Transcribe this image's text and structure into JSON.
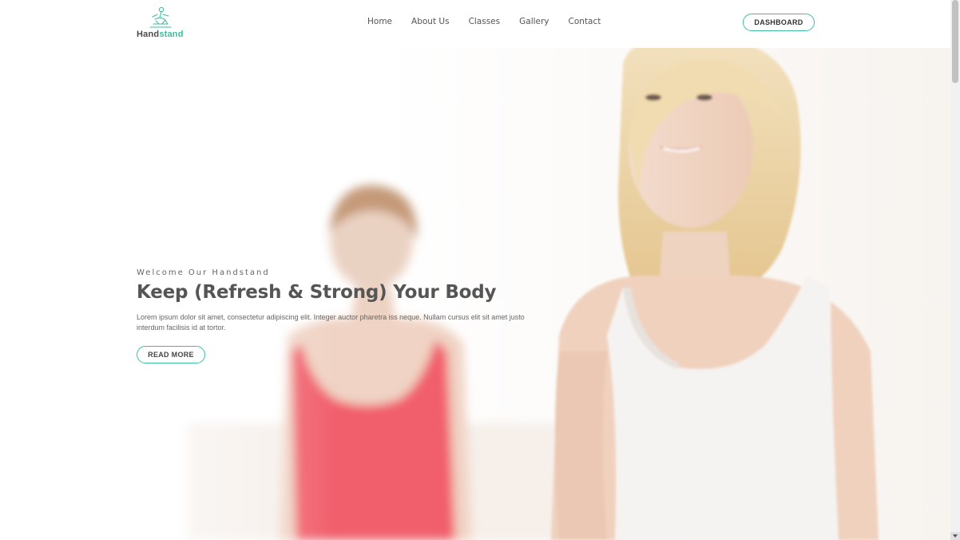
{
  "brand": {
    "name_part1": "Hand",
    "name_part2": "stand",
    "accent_color": "#3bbf9f",
    "logo_icon": "yoga-pose-icon"
  },
  "nav": {
    "items": [
      {
        "label": "Home"
      },
      {
        "label": "About Us"
      },
      {
        "label": "Classes"
      },
      {
        "label": "Gallery"
      },
      {
        "label": "Contact"
      }
    ],
    "dashboard_label": "DASHBOARD"
  },
  "hero": {
    "eyebrow": "Welcome Our Handstand",
    "headline": "Keep (Refresh & Strong) Your Body",
    "lead": "Lorem ipsum dolor sit amet, consectetur adipiscing elit. Integer auctor pharetra iss neque. Nullam cursus elit sit amet justo interdum facilisis id at tortor.",
    "cta_label": "READ MORE",
    "image": "yoga-women-photo"
  }
}
